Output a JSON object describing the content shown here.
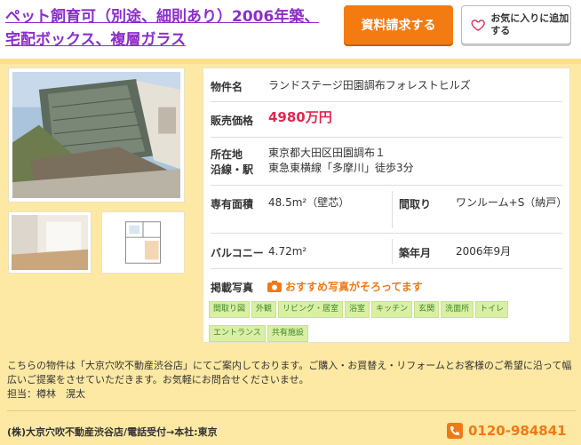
{
  "header": {
    "title": "ペット飼育可（別途、細則あり）2006年築、宅配ボックス、複層ガラス",
    "request_button": "資料請求する",
    "favorite_button": "お気に入りに追加する"
  },
  "property": {
    "name_label": "物件名",
    "name_value": "ランドステージ田園調布フォレストヒルズ",
    "price_label": "販売価格",
    "price_value": "4980万円",
    "location_label": "所在地",
    "location_value": "東京都大田区田園調布１",
    "line_label": "沿線・駅",
    "line_value": "東急東横線「多摩川」徒歩3分",
    "area_label": "専有面積",
    "area_value": "48.5m²（壁芯）",
    "layout_label": "間取り",
    "layout_value": "ワンルーム+S（納戸）",
    "balcony_label": "バルコニー",
    "balcony_value": "4.72m²",
    "built_label": "築年月",
    "built_value": "2006年9月",
    "photos_label": "掲載写真",
    "photos_note": "おすすめ写真がそろってます",
    "photo_tags": [
      "間取り図",
      "外観",
      "リビング・居室",
      "浴室",
      "キッチン",
      "玄関",
      "洗面所",
      "トイレ",
      "エントランス",
      "共有施設"
    ]
  },
  "description": {
    "text": "こちらの物件は「大京穴吹不動産渋谷店」にてご案内しております。ご購入・お買替え・リフォームとお客様のご希望に沿って幅広いご提案をさせていただきます。お気軽にお問合せくださいませ。",
    "staff": "担当：樽林　滉太"
  },
  "footer": {
    "company": "(株)大京穴吹不動産渋谷店/電話受付→本社:東京",
    "phone": "0120-984841"
  },
  "colors": {
    "accent_orange": "#f47a12",
    "title_purple": "#8a2ec9",
    "price_red": "#e0284f",
    "panel_yellow": "#fde9a3"
  }
}
